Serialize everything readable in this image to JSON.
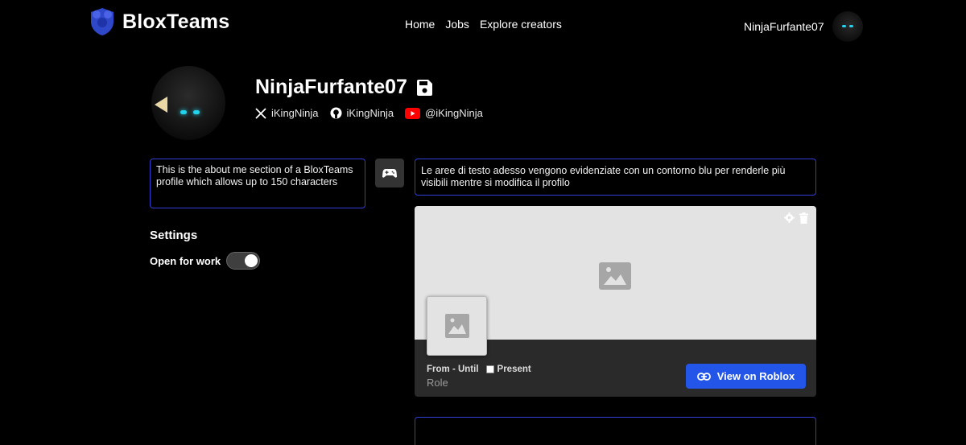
{
  "nav": {
    "brand": "BloxTeams",
    "links": [
      "Home",
      "Jobs",
      "Explore creators"
    ],
    "username": "NinjaFurfante07"
  },
  "profile": {
    "username": "NinjaFurfante07",
    "socials": {
      "x": "iKingNinja",
      "github": "iKingNinja",
      "youtube": "@iKingNinja"
    },
    "about": "This is the about me section of a BloxTeams profile which allows up to 150 characters"
  },
  "settings": {
    "title": "Settings",
    "open_for_work_label": "Open for work",
    "open_for_work": true
  },
  "description": "Le aree di testo adesso vengono evidenziate con un contorno blu per renderle più visibili mentre si modifica il profilo",
  "experience": {
    "dates_label": "From - Until",
    "present_label": "Present",
    "present_checked": false,
    "role_placeholder": "Role",
    "view_button": "View on Roblox"
  },
  "colors": {
    "accent": "#2356e8",
    "outline": "#2d3fd6",
    "banner": "#e3e3e3",
    "card": "#2a2a2a"
  }
}
